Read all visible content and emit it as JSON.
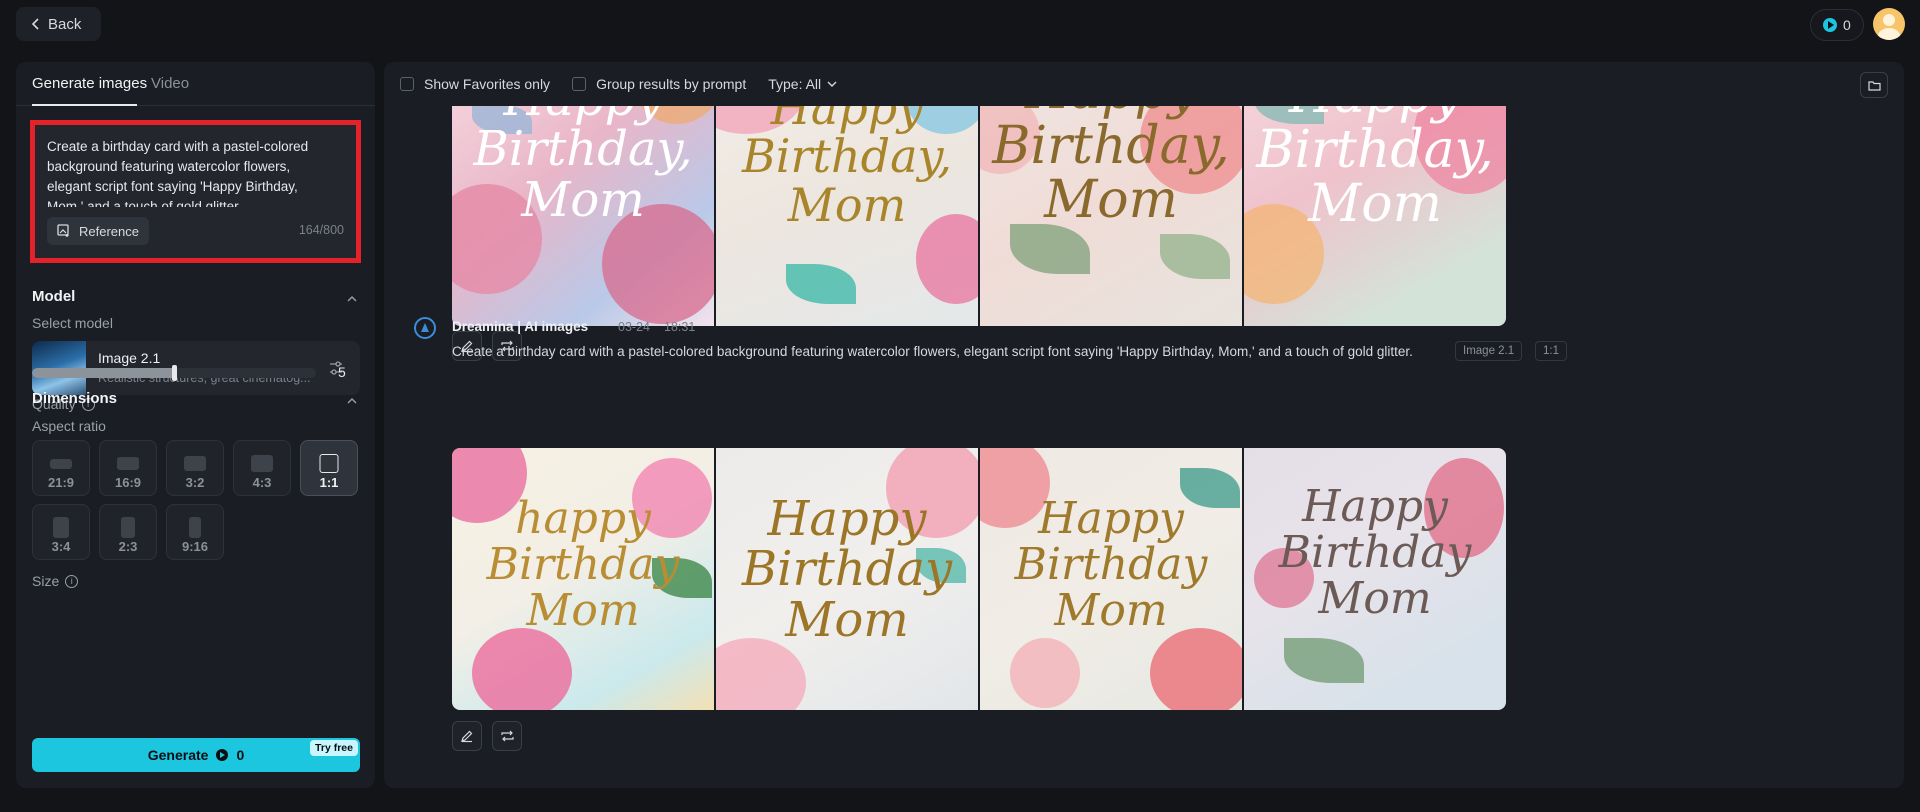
{
  "topbar": {
    "back_label": "Back",
    "credits": "0"
  },
  "left": {
    "tabs": [
      {
        "label": "Generate images",
        "active": true
      },
      {
        "label": "Video",
        "active": false
      }
    ],
    "prompt": {
      "text": "Create a birthday card with a pastel-colored background featuring watercolor flowers, elegant script font saying 'Happy Birthday, Mom,' and a touch of gold glitter.",
      "reference_label": "Reference",
      "char_count": "164/800"
    },
    "model": {
      "section_title": "Model",
      "select_label": "Select model",
      "name": "Image 2.1",
      "description": "Realistic structures, great cinematog..."
    },
    "quality": {
      "label": "Quality",
      "value": "5",
      "fraction": 0.5
    },
    "dimensions": {
      "section_title": "Dimensions",
      "aspect_label": "Aspect ratio",
      "ratios": [
        {
          "label": "21:9",
          "selected": false
        },
        {
          "label": "16:9",
          "selected": false
        },
        {
          "label": "3:2",
          "selected": false
        },
        {
          "label": "4:3",
          "selected": false
        },
        {
          "label": "1:1",
          "selected": true
        },
        {
          "label": "3:4",
          "selected": false
        },
        {
          "label": "2:3",
          "selected": false
        },
        {
          "label": "9:16",
          "selected": false
        }
      ],
      "size_label": "Size"
    },
    "generate": {
      "label": "Generate",
      "cost": "0",
      "badge": "Try free"
    }
  },
  "main": {
    "filters": {
      "favorites_label": "Show Favorites only",
      "group_label": "Group results by prompt",
      "type_label": "Type: All"
    },
    "card_text": [
      "Happy",
      "Birthday,",
      "Mom"
    ],
    "card_text_lower": [
      "happy",
      "Birthday",
      "Mom"
    ],
    "generation": {
      "author": "Dreamina | AI images",
      "date": "03-24",
      "time": "18:31",
      "prompt": "Create a birthday card with a pastel-colored background featuring watercolor flowers, elegant script font saying 'Happy Birthday, Mom,' and a touch of gold glitter.",
      "model_tag": "Image 2.1",
      "ratio_tag": "1:1"
    },
    "colors": {
      "accent": "#1cc6df",
      "highlight_border": "#e3222a"
    }
  }
}
